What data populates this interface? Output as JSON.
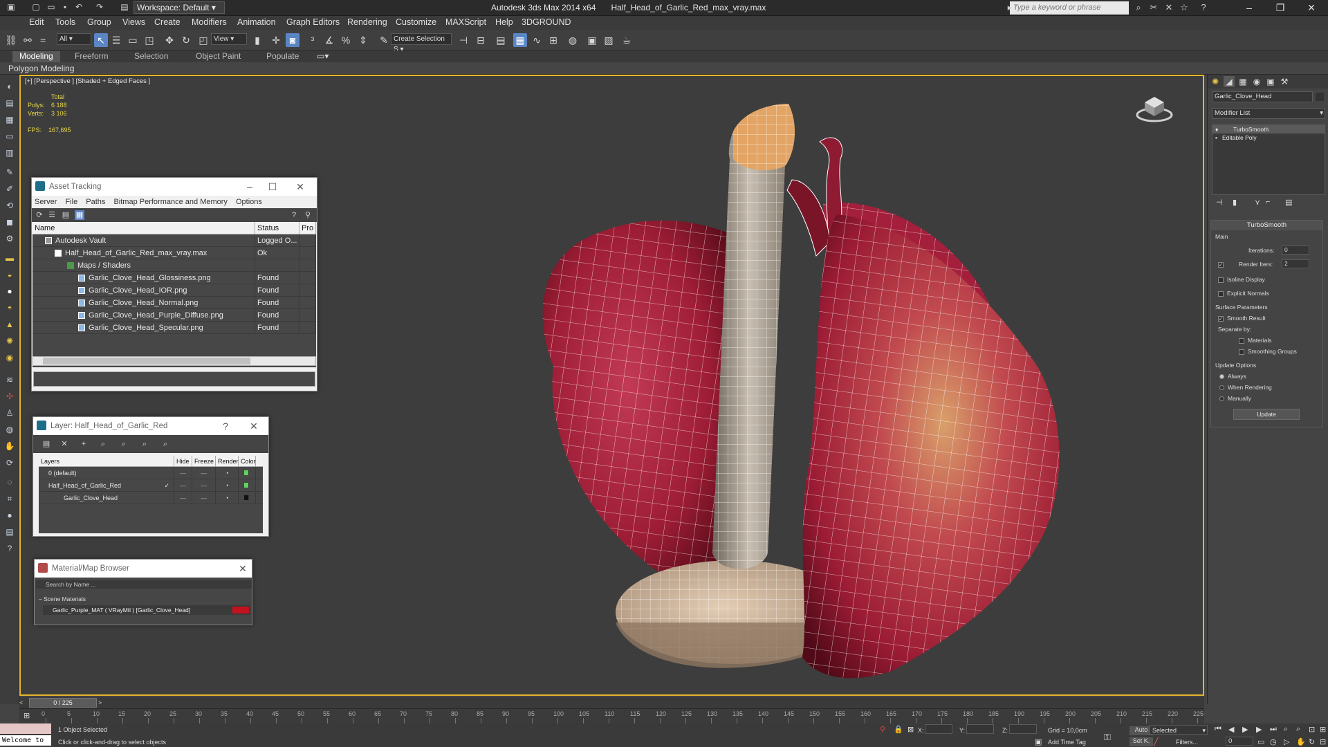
{
  "app": {
    "title": "Autodesk 3ds Max  2014 x64",
    "file": "Half_Head_of_Garlic_Red_max_vray.max",
    "workspace": "Workspace: Default",
    "search_placeholder": "Type a keyword or phrase"
  },
  "menu": [
    "Edit",
    "Tools",
    "Group",
    "Views",
    "Create",
    "Modifiers",
    "Animation",
    "Graph Editors",
    "Rendering",
    "Customize",
    "MAXScript",
    "Help",
    "3DGROUND"
  ],
  "toolbar": {
    "filter": "All",
    "view": "View",
    "selection_set": "Create Selection S"
  },
  "ribbon": {
    "tabs": [
      "Modeling",
      "Freeform",
      "Selection",
      "Object Paint",
      "Populate"
    ],
    "active_tab": "Modeling",
    "subtitle": "Polygon Modeling"
  },
  "viewport": {
    "label": "[+] [Perspective ] [Shaded + Edged Faces ]",
    "stats": {
      "total_label": "Total",
      "polys_label": "Polys:",
      "polys": "6 188",
      "verts_label": "Verts:",
      "verts": "3 106",
      "fps_label": "FPS:",
      "fps": "167,695"
    }
  },
  "asset_tracking": {
    "title": "Asset Tracking",
    "menu": [
      "Server",
      "File",
      "Paths",
      "Bitmap Performance and Memory",
      "Options"
    ],
    "columns": [
      "Name",
      "Status",
      "Pro"
    ],
    "rows": [
      {
        "name": "Autodesk Vault",
        "status": "Logged O...",
        "indent": 1
      },
      {
        "name": "Half_Head_of_Garlic_Red_max_vray.max",
        "status": "Ok",
        "indent": 2
      },
      {
        "name": "Maps / Shaders",
        "status": "",
        "indent": 3
      },
      {
        "name": "Garlic_Clove_Head_Glossiness.png",
        "status": "Found",
        "indent": 4
      },
      {
        "name": "Garlic_Clove_Head_IOR.png",
        "status": "Found",
        "indent": 4
      },
      {
        "name": "Garlic_Clove_Head_Normal.png",
        "status": "Found",
        "indent": 4
      },
      {
        "name": "Garlic_Clove_Head_Purple_Diffuse.png",
        "status": "Found",
        "indent": 4
      },
      {
        "name": "Garlic_Clove_Head_Specular.png",
        "status": "Found",
        "indent": 4
      }
    ]
  },
  "layer_dialog": {
    "title": "Layer: Half_Head_of_Garlic_Red",
    "help": "?",
    "columns": [
      "Layers",
      "Hide",
      "Freeze",
      "Render",
      "Color"
    ],
    "rows": [
      {
        "name": "0 (default)",
        "color": "#5fd35f"
      },
      {
        "name": "Half_Head_of_Garlic_Red",
        "color": "#5fd35f"
      },
      {
        "name": "Garlic_Clove_Head",
        "color": "#111111"
      }
    ]
  },
  "material_browser": {
    "title": "Material/Map Browser",
    "search_placeholder": "Search by Name ...",
    "group": "Scene Materials",
    "item": "Garlic_Purple_MAT  ( VRayMtl )  [Garlic_Clove_Head]"
  },
  "command_panel": {
    "object_name": "Garlic_Clove_Head",
    "modifier_list": "Modifier List",
    "stack": [
      "TurboSmooth",
      "Editable Poly"
    ],
    "turbosmooth": {
      "title": "TurboSmooth",
      "main": "Main",
      "iterations_label": "Iterations:",
      "iterations": "0",
      "render_iters_label": "Render Iters:",
      "render_iters": "2",
      "isoline": "Isoline Display",
      "explicit_normals": "Explicit Normals",
      "surface_params": "Surface Parameters",
      "smooth_result": "Smooth Result",
      "separate_by": "Separate by:",
      "materials": "Materials",
      "smoothing_groups": "Smoothing Groups",
      "update_options": "Update Options",
      "always": "Always",
      "when_rendering": "When Rendering",
      "manually": "Manually",
      "update": "Update"
    }
  },
  "timeline": {
    "frame": "0 / 225",
    "ticks": [
      "0",
      "5",
      "10",
      "15",
      "20",
      "25",
      "30",
      "35",
      "40",
      "45",
      "50",
      "55",
      "60",
      "65",
      "70",
      "75",
      "80",
      "85",
      "90",
      "95",
      "100",
      "105",
      "110",
      "115",
      "120",
      "125",
      "130",
      "135",
      "140",
      "145",
      "150",
      "155",
      "160",
      "165",
      "170",
      "175",
      "180",
      "185",
      "190",
      "195",
      "200",
      "205",
      "210",
      "215",
      "220",
      "225"
    ]
  },
  "status": {
    "welcome": "Welcome to",
    "selected": "1 Object Selected",
    "prompt": "Click or click-and-drag to select objects",
    "x": "X:",
    "y": "Y:",
    "z": "Z:",
    "grid": "Grid = 10,0cm",
    "add_time_tag": "Add Time Tag",
    "auto": "Auto",
    "set_key": "Set K.",
    "key_filter": "Selected",
    "filters": "Filters...",
    "frame_field": "0"
  },
  "colors": {
    "viewport_border": "#e5b62a",
    "garlic_red": "#a8213c",
    "wire": "#ffffff"
  }
}
